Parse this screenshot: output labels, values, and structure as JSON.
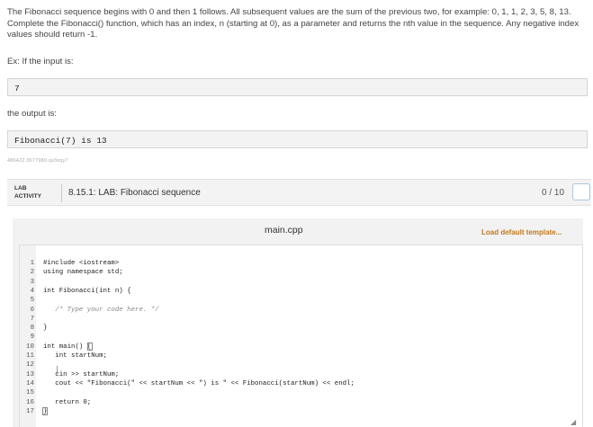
{
  "description": {
    "paragraph": "The Fibonacci sequence begins with 0 and then 1 follows. All subsequent values are the sum of the previous two, for example: 0, 1, 1, 2, 3, 5, 8, 13. Complete the Fibonacci() function, which has an index, n (starting at 0), as a parameter and returns the nth value in the sequence. Any negative index values should return -1.",
    "example_label": "Ex: If the input is:",
    "input_value": "7",
    "output_label": "the output is:",
    "output_value": "Fibonacci(7) is 13",
    "hash": "486422.3677980.qx3zqy7"
  },
  "lab": {
    "tag_line1": "LAB",
    "tag_line2": "ACTIVITY",
    "title": "8.15.1: LAB: Fibonacci sequence",
    "score": "0 / 10"
  },
  "editor": {
    "file_name": "main.cpp",
    "load_template": "Load default template...",
    "lines": [
      {
        "num": "1",
        "text": "#include <iostream>"
      },
      {
        "num": "2",
        "text": "using namespace std;"
      },
      {
        "num": "3",
        "text": ""
      },
      {
        "num": "4",
        "text": "int Fibonacci(int n) {"
      },
      {
        "num": "5",
        "text": ""
      },
      {
        "num": "6",
        "text": "   /* Type your code here. */"
      },
      {
        "num": "7",
        "text": ""
      },
      {
        "num": "8",
        "text": "}"
      },
      {
        "num": "9",
        "text": ""
      },
      {
        "num": "10",
        "text": "int main() {"
      },
      {
        "num": "11",
        "text": "   int startNum;"
      },
      {
        "num": "12",
        "text": ""
      },
      {
        "num": "13",
        "text": "   cin >> startNum;"
      },
      {
        "num": "14",
        "text": "   cout << \"Fibonacci(\" << startNum << \") is \" << Fibonacci(startNum) << endl;"
      },
      {
        "num": "15",
        "text": ""
      },
      {
        "num": "16",
        "text": "   return 0;"
      },
      {
        "num": "17",
        "text": "}"
      }
    ]
  }
}
